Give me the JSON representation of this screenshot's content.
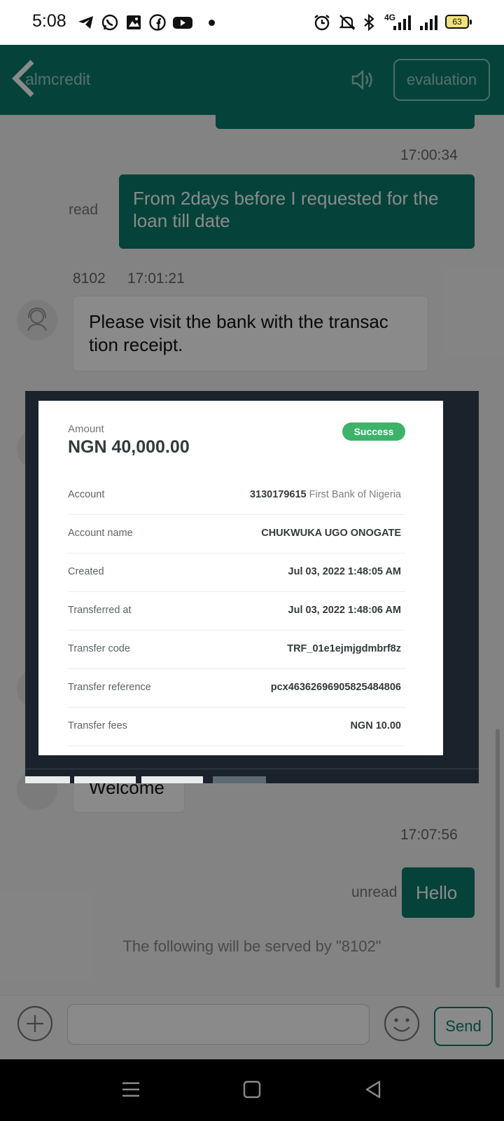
{
  "status_bar": {
    "time": "5:08",
    "network": "4G",
    "battery": "63",
    "icons": [
      "telegram-icon",
      "whatsapp-icon",
      "gallery-icon",
      "facebook-icon",
      "youtube-icon",
      "dot-icon",
      "alarm-icon",
      "mute-icon",
      "bluetooth-icon",
      "signal-icon",
      "signal-icon"
    ]
  },
  "header": {
    "title": "almcredit",
    "evaluation_label": "evaluation"
  },
  "messages": [
    {
      "type": "timestamp",
      "time": "17:00:34"
    },
    {
      "type": "outgoing",
      "text": "From 2days before I requested for the loan till date",
      "status": "read"
    },
    {
      "type": "agent_meta",
      "agent_id": "8102",
      "time": "17:01:21"
    },
    {
      "type": "incoming",
      "text": "Please visit the bank with the transac tion receipt."
    },
    {
      "type": "incoming",
      "text": "Welcome"
    },
    {
      "type": "timestamp",
      "time": "17:07:56"
    },
    {
      "type": "outgoing",
      "text": "Hello",
      "status": "unread"
    },
    {
      "type": "system",
      "text": "The following will be served by \"8102\""
    }
  ],
  "receipt": {
    "amount_label": "Amount",
    "amount": "NGN 40,000.00",
    "status": "Success",
    "rows": [
      {
        "label": "Account",
        "value": "3130179615",
        "value_suffix": "First Bank of Nigeria"
      },
      {
        "label": "Account name",
        "value": "CHUKWUKA UGO ONOGATE"
      },
      {
        "label": "Created",
        "value": "Jul 03, 2022 1:48:05 AM"
      },
      {
        "label": "Transferred at",
        "value": "Jul 03, 2022 1:48:06 AM"
      },
      {
        "label": "Transfer code",
        "value": "TRF_01e1ejmjgdmbrf8z"
      },
      {
        "label": "Transfer reference",
        "value": "pcx46362696905825484806"
      },
      {
        "label": "Transfer fees",
        "value": "NGN 10.00"
      }
    ]
  },
  "input_bar": {
    "placeholder": "",
    "send_label": "Send"
  },
  "colors": {
    "brand": "#0a7d6c",
    "success": "#3db36a"
  }
}
